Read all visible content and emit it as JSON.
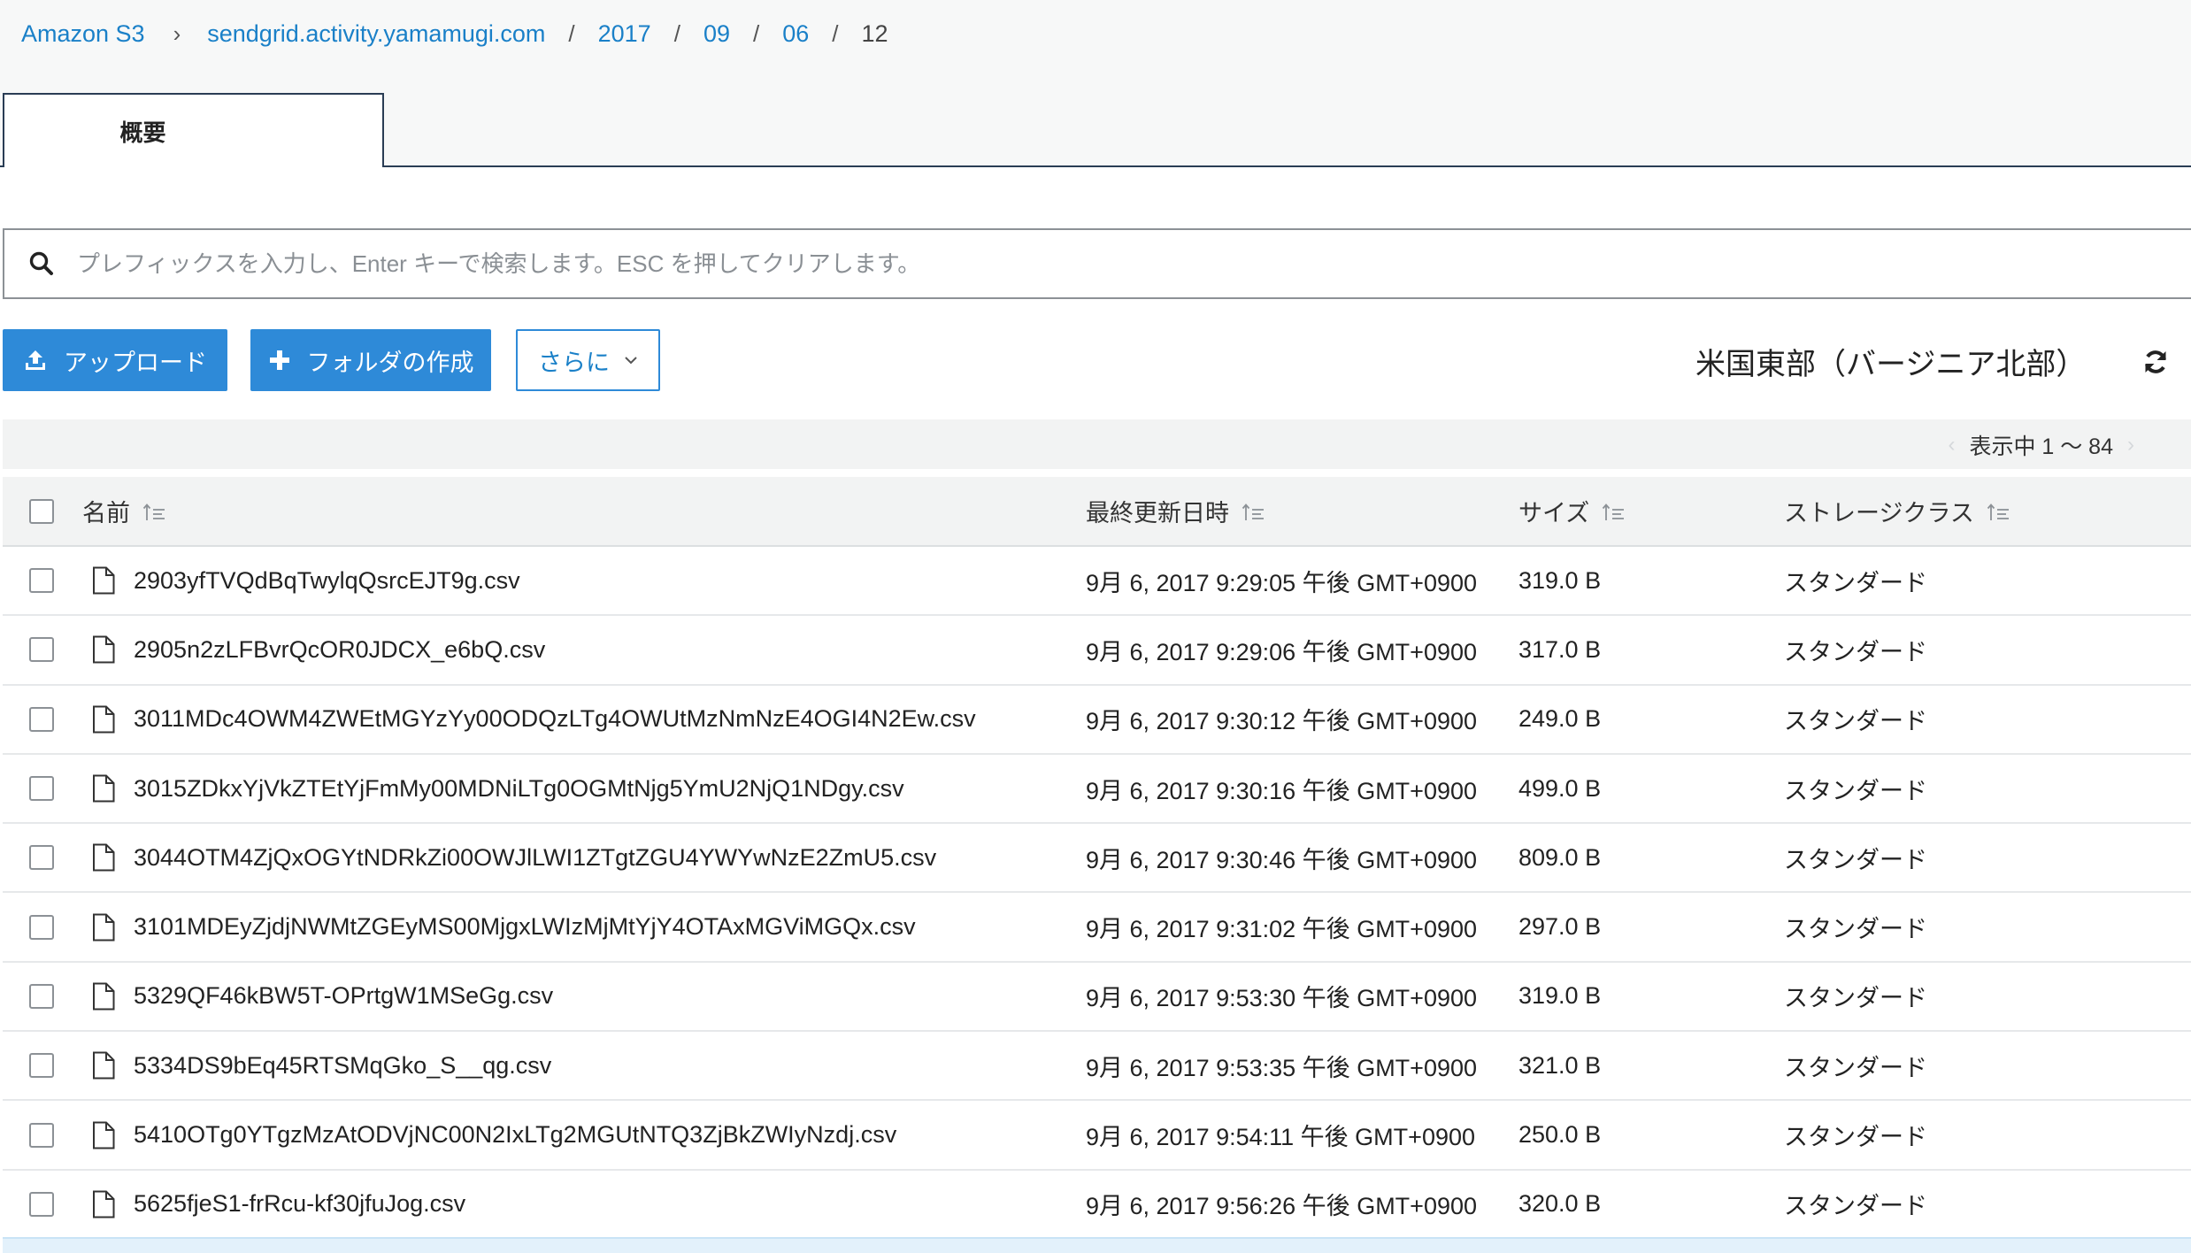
{
  "breadcrumb": {
    "root": "Amazon S3",
    "bucket": "sendgrid.activity.yamamugi.com",
    "path": [
      "2017",
      "09",
      "06"
    ],
    "current": "12",
    "separator": "/"
  },
  "tabs": [
    {
      "label": "概要"
    }
  ],
  "search": {
    "value": "",
    "placeholder": "プレフィックスを入力し、Enter キーで検索します。ESC を押してクリアします。"
  },
  "toolbar": {
    "upload_label": "アップロード",
    "create_folder_label": "フォルダの作成",
    "more_label": "さらに"
  },
  "region": "米国東部（バージニア北部）",
  "pager": {
    "label": "表示中 1 〜 84"
  },
  "table": {
    "headers": {
      "name": "名前",
      "modified": "最終更新日時",
      "size": "サイズ",
      "storage_class": "ストレージクラス"
    },
    "rows": [
      {
        "name": "2903yfTVQdBqTwylqQsrcEJT9g.csv",
        "modified": "9月 6, 2017 9:29:05 午後 GMT+0900",
        "size": "319.0 B",
        "storage_class": "スタンダード"
      },
      {
        "name": "2905n2zLFBvrQcOR0JDCX_e6bQ.csv",
        "modified": "9月 6, 2017 9:29:06 午後 GMT+0900",
        "size": "317.0 B",
        "storage_class": "スタンダード"
      },
      {
        "name": "3011MDc4OWM4ZWEtMGYzYy00ODQzLTg4OWUtMzNmNzE4OGI4N2Ew.csv",
        "modified": "9月 6, 2017 9:30:12 午後 GMT+0900",
        "size": "249.0 B",
        "storage_class": "スタンダード"
      },
      {
        "name": "3015ZDkxYjVkZTEtYjFmMy00MDNiLTg0OGMtNjg5YmU2NjQ1NDgy.csv",
        "modified": "9月 6, 2017 9:30:16 午後 GMT+0900",
        "size": "499.0 B",
        "storage_class": "スタンダード"
      },
      {
        "name": "3044OTM4ZjQxOGYtNDRkZi00OWJlLWI1ZTgtZGU4YWYwNzE2ZmU5.csv",
        "modified": "9月 6, 2017 9:30:46 午後 GMT+0900",
        "size": "809.0 B",
        "storage_class": "スタンダード"
      },
      {
        "name": "3101MDEyZjdjNWMtZGEyMS00MjgxLWIzMjMtYjY4OTAxMGViMGQx.csv",
        "modified": "9月 6, 2017 9:31:02 午後 GMT+0900",
        "size": "297.0 B",
        "storage_class": "スタンダード"
      },
      {
        "name": "5329QF46kBW5T-OPrtgW1MSeGg.csv",
        "modified": "9月 6, 2017 9:53:30 午後 GMT+0900",
        "size": "319.0 B",
        "storage_class": "スタンダード"
      },
      {
        "name": "5334DS9bEq45RTSMqGko_S__qg.csv",
        "modified": "9月 6, 2017 9:53:35 午後 GMT+0900",
        "size": "321.0 B",
        "storage_class": "スタンダード"
      },
      {
        "name": "5410OTg0YTgzMzAtODVjNC00N2IxLTg2MGUtNTQ3ZjBkZWIyNzdj.csv",
        "modified": "9月 6, 2017 9:54:11 午後 GMT+0900",
        "size": "250.0 B",
        "storage_class": "スタンダード"
      },
      {
        "name": "5625fjeS1-frRcu-kf30jfuJog.csv",
        "modified": "9月 6, 2017 9:56:26 午後 GMT+0900",
        "size": "320.0 B",
        "storage_class": "スタンダード"
      }
    ]
  },
  "colors": {
    "link": "#1a80c8",
    "primary_button": "#2e8ad8",
    "tab_border": "#2a3d55"
  },
  "icons": [
    "search-icon",
    "upload-icon",
    "plus-icon",
    "chevron-down-icon",
    "refresh-icon",
    "sort-icon",
    "file-icon",
    "checkbox"
  ]
}
